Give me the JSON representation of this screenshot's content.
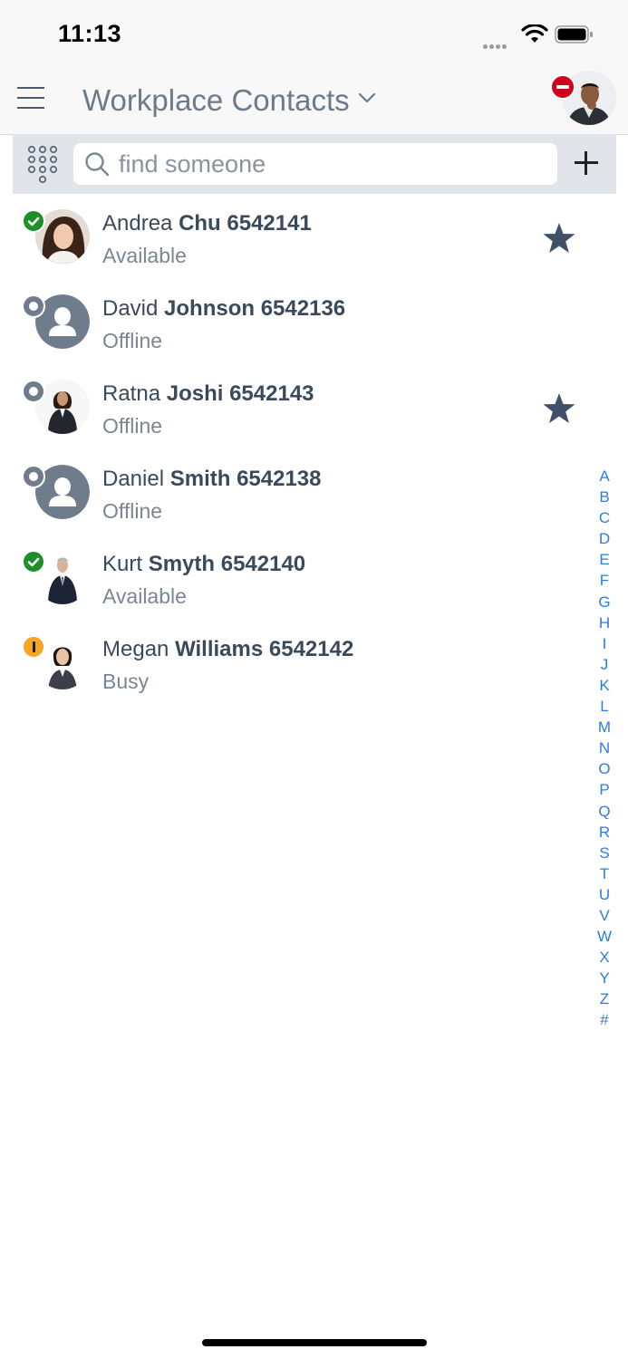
{
  "status_bar": {
    "time": "11:13"
  },
  "header": {
    "title": "Workplace Contacts"
  },
  "search": {
    "placeholder": "find someone",
    "value": ""
  },
  "contacts": [
    {
      "first": "Andrea",
      "last": "Chu",
      "number": "6542141",
      "status": "Available",
      "presence": "available",
      "favorite": true
    },
    {
      "first": "David",
      "last": "Johnson",
      "number": "6542136",
      "status": "Offline",
      "presence": "offline",
      "favorite": false
    },
    {
      "first": "Ratna",
      "last": "Joshi",
      "number": "6542143",
      "status": "Offline",
      "presence": "offline",
      "favorite": true
    },
    {
      "first": "Daniel",
      "last": "Smith",
      "number": "6542138",
      "status": "Offline",
      "presence": "offline",
      "favorite": false
    },
    {
      "first": "Kurt",
      "last": "Smyth",
      "number": "6542140",
      "status": "Available",
      "presence": "available",
      "favorite": false
    },
    {
      "first": "Megan",
      "last": "Williams",
      "number": "6542142",
      "status": "Busy",
      "presence": "busy",
      "favorite": false
    }
  ],
  "alphabet": [
    "A",
    "B",
    "C",
    "D",
    "E",
    "F",
    "G",
    "H",
    "I",
    "J",
    "K",
    "L",
    "M",
    "N",
    "O",
    "P",
    "Q",
    "R",
    "S",
    "T",
    "U",
    "V",
    "W",
    "X",
    "Y",
    "Z",
    "#"
  ],
  "colors": {
    "accent": "#2a7de1",
    "available": "#1e8f2a",
    "offline": "#6f7c8b",
    "busy": "#f5a623",
    "dnd": "#d0021b",
    "star": "#3f5068"
  },
  "icons": {
    "menu": "hamburger-menu-icon",
    "chevron": "chevron-down-icon",
    "dialpad": "dialpad-icon",
    "search": "search-icon",
    "add": "plus-icon",
    "favorite": "star-icon"
  }
}
